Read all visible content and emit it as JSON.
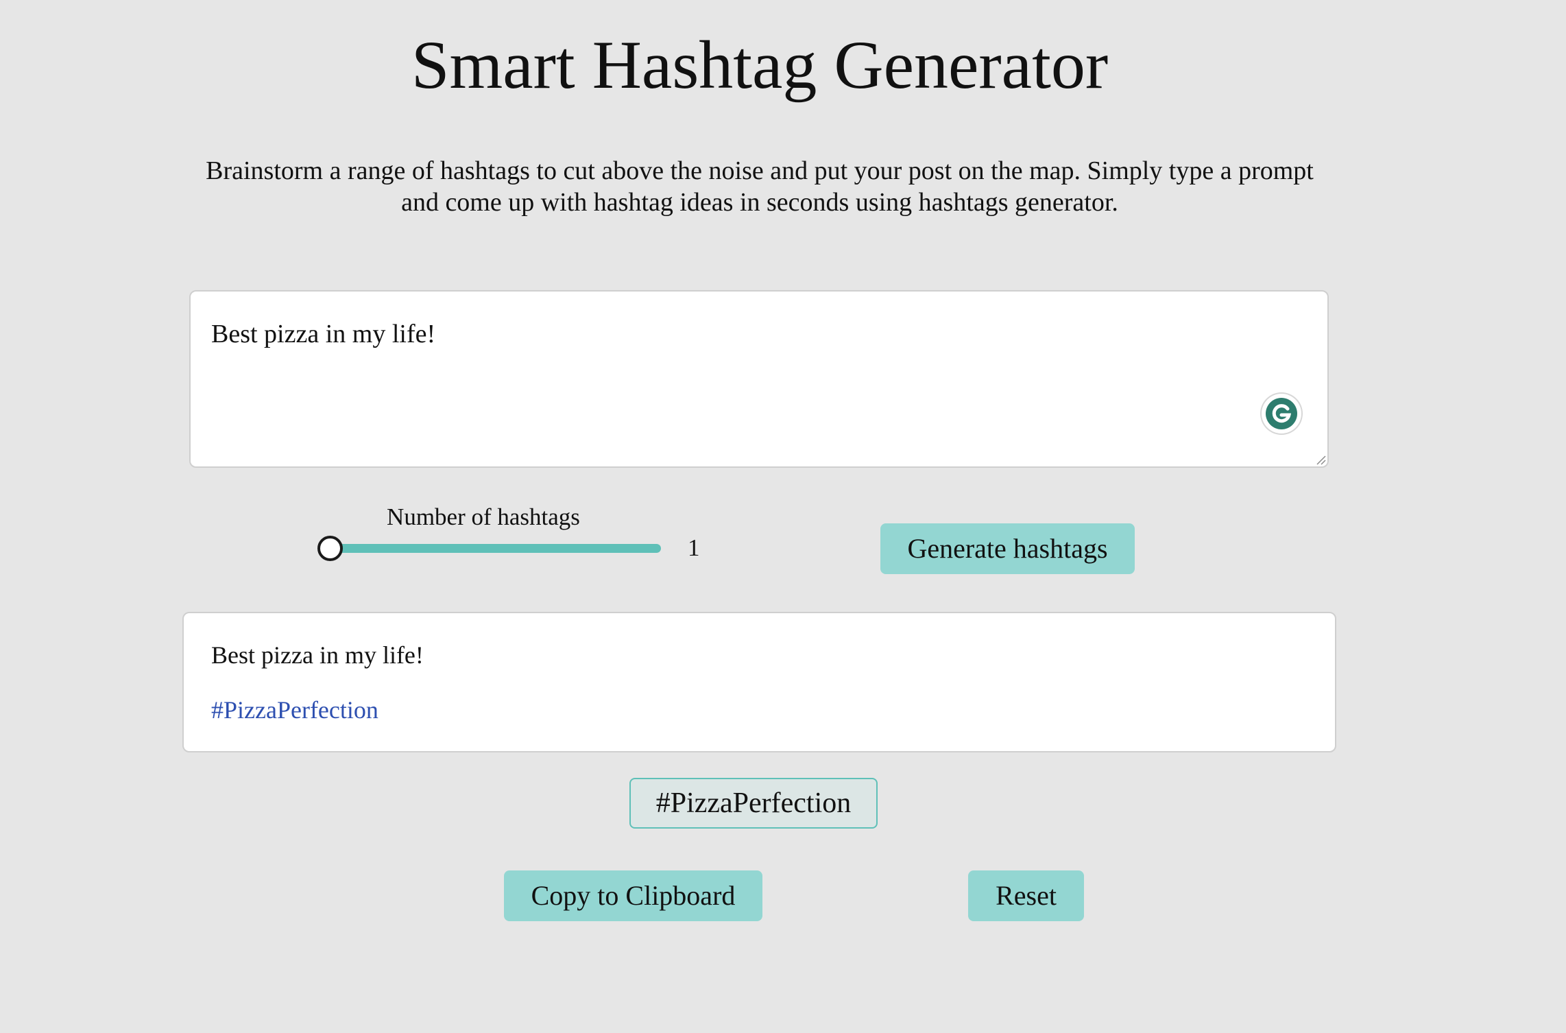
{
  "header": {
    "title": "Smart Hashtag Generator",
    "subtitle": "Brainstorm a range of hashtags to cut above the noise and put your post on the map. Simply type a prompt and come up with hashtag ideas in seconds using hashtags generator."
  },
  "prompt": {
    "value": "Best pizza in my life!"
  },
  "controls": {
    "slider_label": "Number of hashtags",
    "slider_value": "1",
    "slider_fraction": 0,
    "generate_label": "Generate hashtags"
  },
  "output": {
    "text": "Best pizza in my life!",
    "hashtag": "#PizzaPerfection"
  },
  "chips": [
    "#PizzaPerfection"
  ],
  "actions": {
    "copy_label": "Copy to Clipboard",
    "reset_label": "Reset"
  },
  "colors": {
    "background": "#e6e6e6",
    "accent": "#93d6d2",
    "slider": "#5fc0b8",
    "hashtag_link": "#2d4fb0",
    "grammarly": "#2e7d6e"
  },
  "icons": {
    "editor_badge": "grammarly-icon",
    "resize": "resize-handle-icon"
  }
}
